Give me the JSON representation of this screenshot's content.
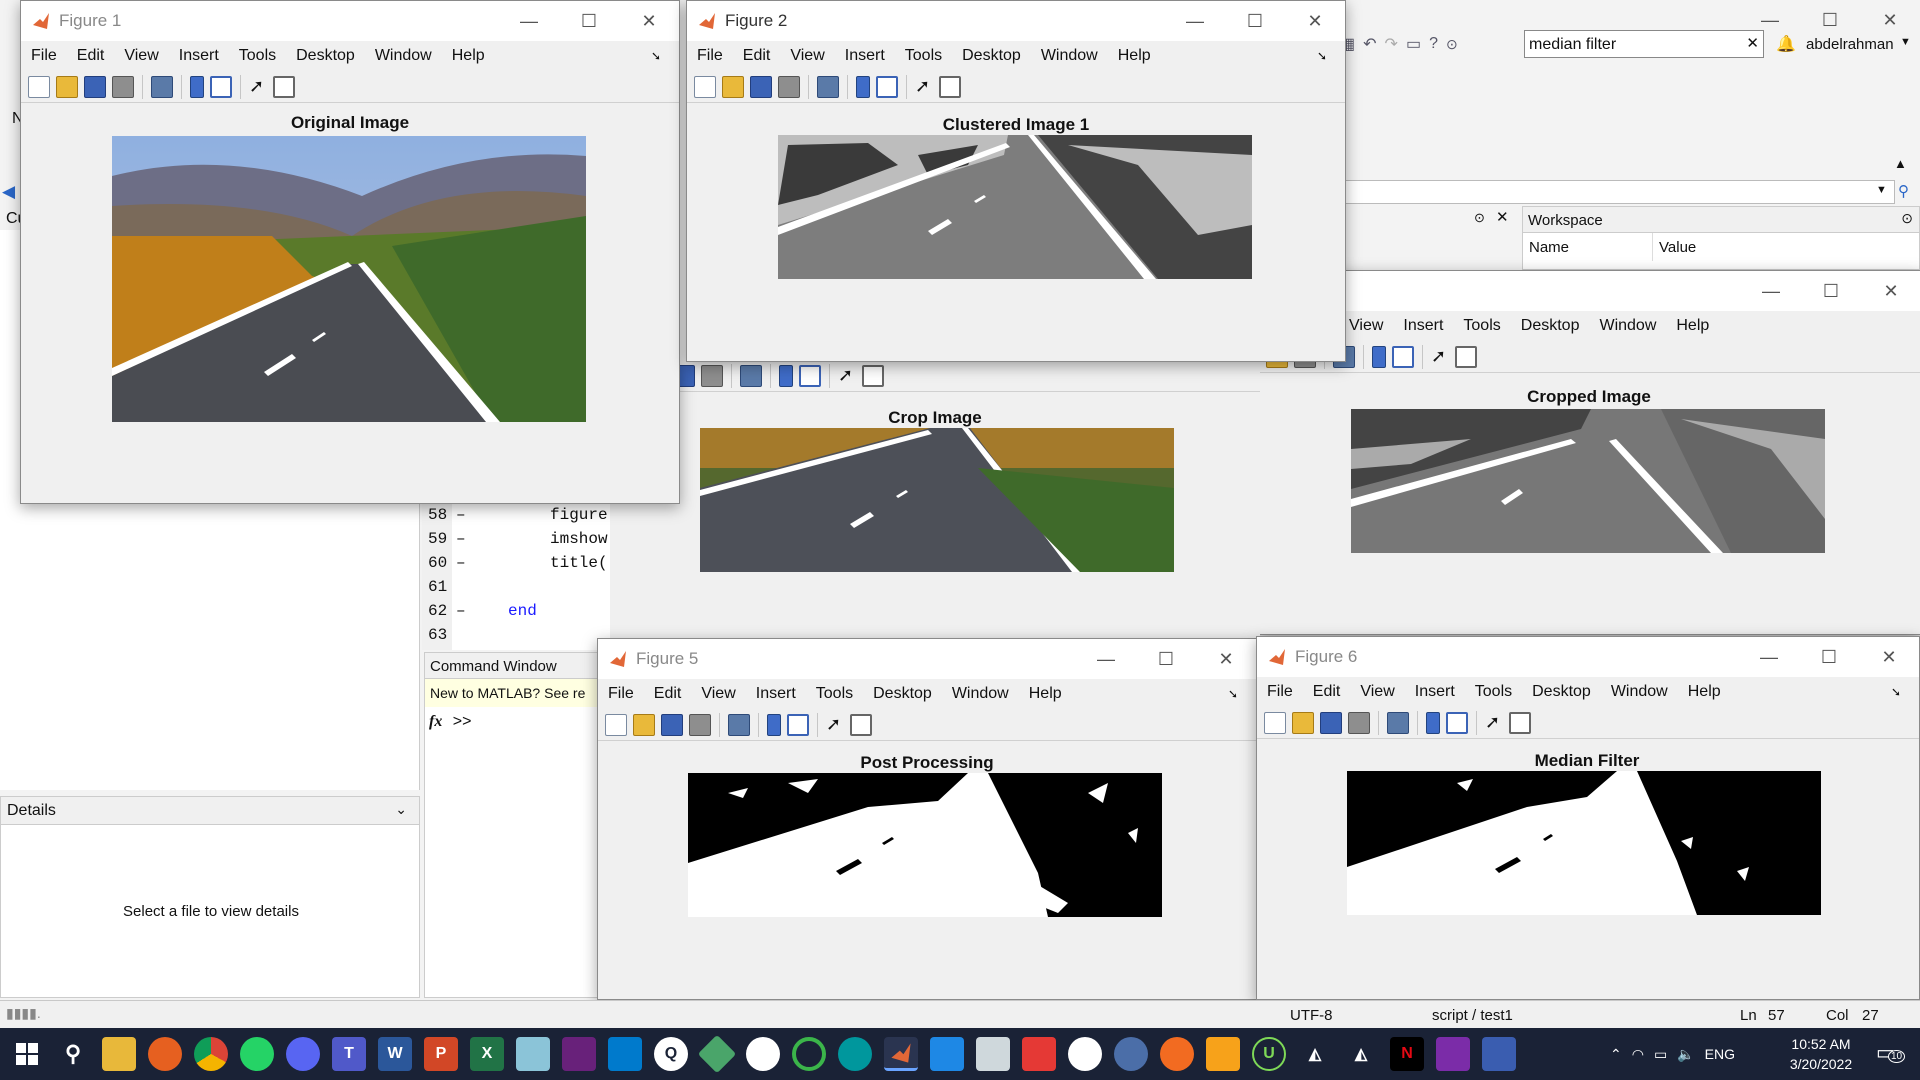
{
  "matlab": {
    "search_value": "median filter",
    "user": "abdelrahman",
    "left_nav_letter": "N",
    "cu_label": "Cu",
    "workspace": {
      "title": "Workspace",
      "col_name": "Name",
      "col_value": "Value"
    },
    "details": {
      "title": "Details",
      "message": "Select a file to view details"
    },
    "editor": {
      "lines": [
        {
          "num": "58",
          "dash": "–",
          "code": "figure"
        },
        {
          "num": "59",
          "dash": "–",
          "code": "imshow"
        },
        {
          "num": "60",
          "dash": "–",
          "code": "title('"
        },
        {
          "num": "61",
          "dash": "",
          "code": ""
        },
        {
          "num": "62",
          "dash": "–",
          "code": "end"
        },
        {
          "num": "63",
          "dash": "",
          "code": ""
        }
      ]
    },
    "command_window": {
      "title": "Command Window",
      "notice": "New to MATLAB? See re",
      "prompt": ">>",
      "fx": "fx"
    },
    "status": {
      "encoding": "UTF-8",
      "script": "script / test1",
      "ln_label": "Ln",
      "ln": "57",
      "col_label": "Col",
      "col": "27"
    }
  },
  "menu_items": [
    "File",
    "Edit",
    "View",
    "Insert",
    "Tools",
    "Desktop",
    "Window",
    "Help"
  ],
  "partial_menu_items": [
    "View",
    "Insert",
    "Tools",
    "Desktop",
    "Window",
    "Help"
  ],
  "figures": {
    "fig1": {
      "title": "Figure 1",
      "axes_title": "Original Image"
    },
    "fig2": {
      "title": "Figure 2",
      "axes_title": "Clustered Image 1"
    },
    "fig3": {
      "axes_title": "Crop Image"
    },
    "fig4": {
      "axes_title": "Cropped Image"
    },
    "fig5": {
      "title": "Figure 5",
      "axes_title": "Post Processing"
    },
    "fig6": {
      "title": "Figure 6",
      "axes_title": "Median Filter"
    }
  },
  "window_buttons": {
    "minimize": "—",
    "maximize": "☐",
    "close": "✕"
  },
  "taskbar": {
    "time": "10:52 AM",
    "date": "3/20/2022",
    "lang": "ENG",
    "notification_count": "10",
    "apps": [
      "windows-start",
      "search",
      "file-explorer",
      "firefox",
      "chrome",
      "whatsapp",
      "discord",
      "teams",
      "word",
      "powerpoint",
      "excel",
      "notepad",
      "visual-studio",
      "vscode",
      "app-q",
      "git",
      "github",
      "circle-app",
      "arduino",
      "matlab",
      "photos",
      "scanner",
      "app-red",
      "itunes",
      "app-browser",
      "app-orange",
      "app-orange2",
      "app-u",
      "unity",
      "unity2",
      "netflix",
      "media",
      "app-blue"
    ]
  },
  "colors": {
    "taskbar": "#1a2236",
    "accent": "#0078d7",
    "matlab_orange": "#e16737"
  }
}
